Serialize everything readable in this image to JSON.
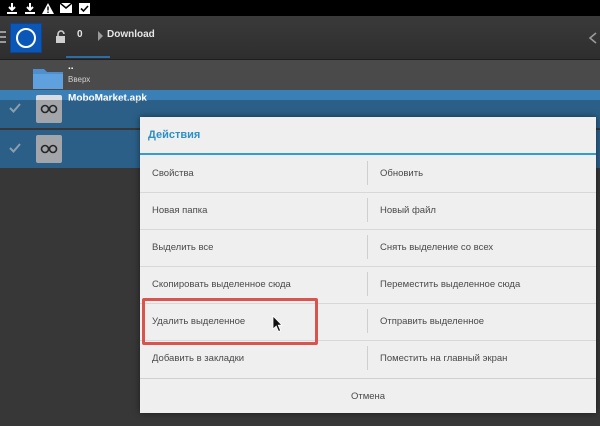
{
  "statusbar": {
    "icons": [
      "download-icon",
      "download-icon",
      "warning-icon",
      "gmail-icon",
      "checkbox-icon"
    ]
  },
  "actionbar": {
    "count": "0",
    "folder": "Download"
  },
  "files": {
    "up_name": "..",
    "up_label": "Вверх",
    "items": [
      {
        "name": "MoboMarket.apk",
        "sub": "",
        "selected": true
      },
      {
        "name": "",
        "sub": "",
        "selected": true
      }
    ]
  },
  "dialog": {
    "title": "Действия",
    "actions": [
      [
        "Свойства",
        "Обновить"
      ],
      [
        "Новая папка",
        "Новый файл"
      ],
      [
        "Выделить все",
        "Снять выделение со всех"
      ],
      [
        "Скопировать выделенное сюда",
        "Переместить выделенное сюда"
      ],
      [
        "Удалить выделенное",
        "Отправить выделенное"
      ],
      [
        "Добавить в закладки",
        "Поместить на главный экран"
      ]
    ],
    "cancel": "Отмена"
  },
  "colors": {
    "accent": "#2d8fc6",
    "selection": "#3a7fb5",
    "highlight": "#d9534f"
  }
}
